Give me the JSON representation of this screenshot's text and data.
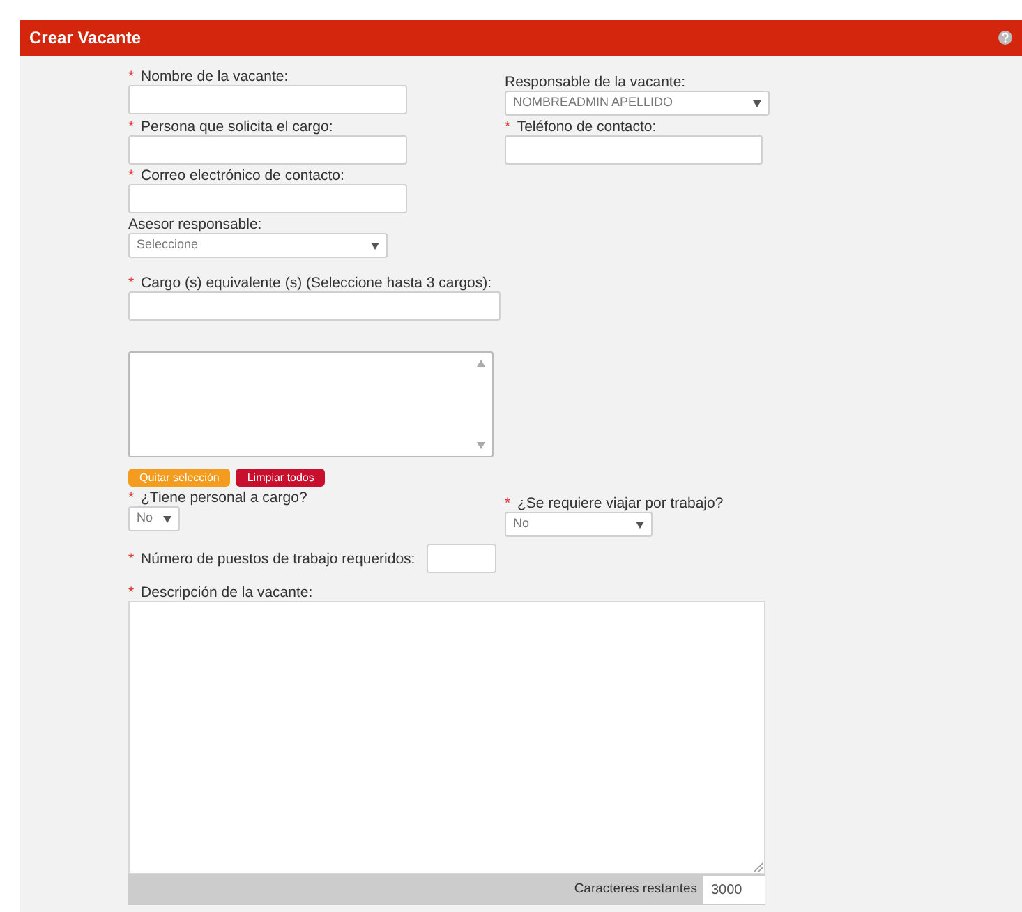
{
  "window": {
    "title": "Crear Vacante"
  },
  "rows": [
    [
      {
        "kind": "text",
        "label": "Nombre de la vacante:",
        "required_mark": "*"
      },
      {
        "kind": "select",
        "label": "Responsable de la vacante:",
        "value": "NOMBREADMIN APELLIDO"
      }
    ],
    [
      {
        "kind": "text",
        "label": "Persona que solicita el cargo:",
        "required_mark": "*"
      },
      {
        "kind": "text",
        "label": "Teléfono de contacto:",
        "required_mark": "*"
      }
    ],
    [
      {
        "kind": "text",
        "label": "Correo electrónico de contacto:",
        "required_mark": "*"
      }
    ],
    [
      {
        "kind": "select",
        "label": "Asesor responsable:",
        "value": "Seleccione"
      }
    ],
    [
      {
        "kind": "text",
        "label": "Cargo (s) equivalente (s) (Seleccione hasta 3 cargos):",
        "required_mark": "*"
      }
    ],
    [
      {
        "kind": "listbox"
      }
    ],
    [
      {
        "kind": "buttons",
        "buttons": [
          {
            "label": "Quitar selección",
            "color": "#f39c1f"
          },
          {
            "label": "Limpiar todos",
            "color": "#c8102e"
          }
        ]
      }
    ],
    [
      {
        "kind": "select",
        "label": "¿Tiene personal a cargo?",
        "required_mark": "*",
        "value": "No"
      },
      {
        "kind": "select",
        "label": "¿Se requiere viajar por trabajo?",
        "required_mark": "*",
        "value": "No"
      }
    ],
    [
      {
        "kind": "inline",
        "label": "Número de puestos de trabajo requeridos:",
        "required_mark": "*"
      }
    ],
    [
      {
        "kind": "textarea",
        "label": "Descripción de la vacante:",
        "required_mark": "*",
        "counter_label": "Caracteres restantes",
        "counter_value": "3000"
      }
    ]
  ]
}
